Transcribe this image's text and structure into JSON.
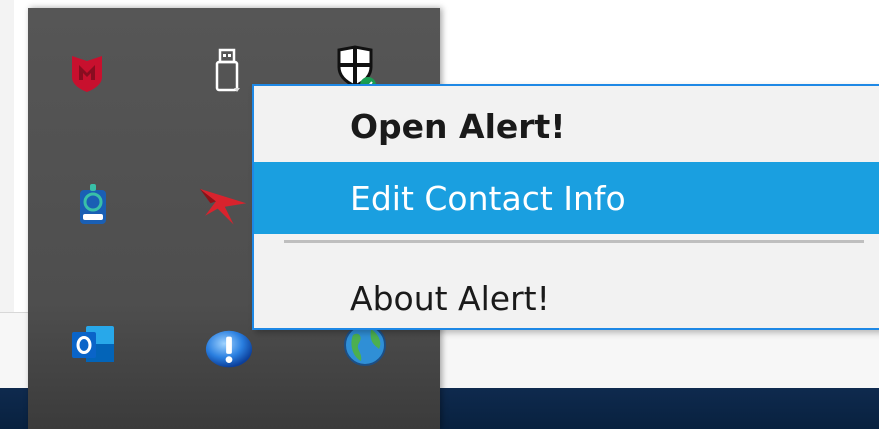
{
  "context_menu": {
    "items": [
      {
        "label": "Open Alert!",
        "bold": true,
        "highlighted": false
      },
      {
        "label": "Edit Contact Info",
        "bold": false,
        "highlighted": true
      },
      {
        "label": "About Alert!",
        "bold": false,
        "highlighted": false
      }
    ]
  },
  "tray_icons": [
    {
      "icon": "mcafee-shield-icon"
    },
    {
      "icon": "usb-drive-icon"
    },
    {
      "icon": "windows-security-icon"
    },
    {
      "icon": "webcam-app-icon"
    },
    {
      "icon": "red-arrow-logo-icon"
    },
    {
      "icon": "globe-network-icon"
    },
    {
      "icon": "outlook-icon"
    },
    {
      "icon": "alert-exclamation-icon"
    }
  ],
  "colors": {
    "menu_highlight": "#1a9fe0",
    "menu_border": "#1e88e5",
    "tray_background": "#525252",
    "taskbar": "#0b2546"
  }
}
